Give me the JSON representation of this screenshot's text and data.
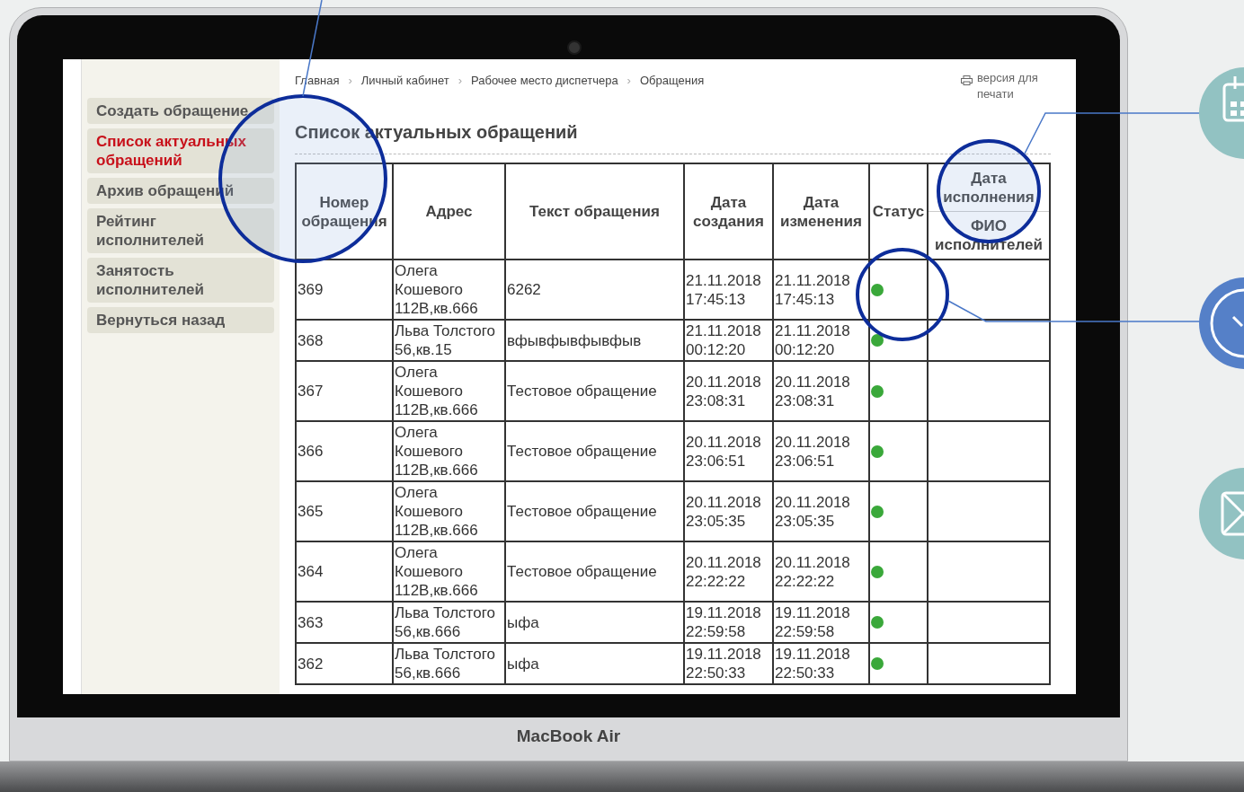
{
  "device_label": "MacBook Air",
  "sidebar": {
    "items": [
      {
        "label": "Создать обращение",
        "selected": false
      },
      {
        "label": "Список актуальных обращений",
        "selected": true
      },
      {
        "label": "Архив обращений",
        "selected": false
      },
      {
        "label": "Рейтинг исполнителей",
        "selected": false
      },
      {
        "label": "Занятость исполнителей",
        "selected": false
      },
      {
        "label": "Вернуться назад",
        "selected": false
      }
    ]
  },
  "breadcrumb_separator": "›",
  "breadcrumbs": [
    "Главная",
    "Личный кабинет",
    "Рабочее место диспетчера",
    "Обращения"
  ],
  "print_link": "версия для печати",
  "title": "Список актуальных обращений",
  "table": {
    "columns": [
      "Номер обращения",
      "Адрес",
      "Текст обращения",
      "Дата создания",
      "Дата изменения",
      "Статус"
    ],
    "split_column": [
      "Дата исполнения",
      "ФИО исполнителей"
    ],
    "rows": [
      {
        "number": "369",
        "address": "Олега Кошевого 112В,кв.666",
        "text": "6262",
        "created": "21.11.2018 17:45:13",
        "modified": "21.11.2018 17:45:13",
        "color": "#3aa83a"
      },
      {
        "number": "368",
        "address": "Льва Толстого 56,кв.15",
        "text": "вфывфывфывфыв",
        "created": "21.11.2018 00:12:20",
        "modified": "21.11.2018 00:12:20",
        "color": "#3aa83a"
      },
      {
        "number": "367",
        "address": "Олега Кошевого 112В,кв.666",
        "text": "Тестовое обращение",
        "created": "20.11.2018 23:08:31",
        "modified": "20.11.2018 23:08:31",
        "color": "#3aa83a"
      },
      {
        "number": "366",
        "address": "Олега Кошевого 112В,кв.666",
        "text": "Тестовое обращение",
        "created": "20.11.2018 23:06:51",
        "modified": "20.11.2018 23:06:51",
        "color": "#3aa83a"
      },
      {
        "number": "365",
        "address": "Олега Кошевого 112В,кв.666",
        "text": "Тестовое обращение",
        "created": "20.11.2018 23:05:35",
        "modified": "20.11.2018 23:05:35",
        "color": "#3aa83a"
      },
      {
        "number": "364",
        "address": "Олега Кошевого 112В,кв.666",
        "text": "Тестовое обращение",
        "created": "20.11.2018 22:22:22",
        "modified": "20.11.2018 22:22:22",
        "color": "#3aa83a"
      },
      {
        "number": "363",
        "address": "Льва Толстого 56,кв.666",
        "text": "ыфа",
        "created": "19.11.2018 22:59:58",
        "modified": "19.11.2018 22:59:58",
        "color": "#3aa83a"
      },
      {
        "number": "362",
        "address": "Льва Толстого 56,кв.666",
        "text": "ыфа",
        "created": "19.11.2018 22:50:33",
        "modified": "19.11.2018 22:50:33",
        "color": "#3aa83a"
      }
    ]
  }
}
